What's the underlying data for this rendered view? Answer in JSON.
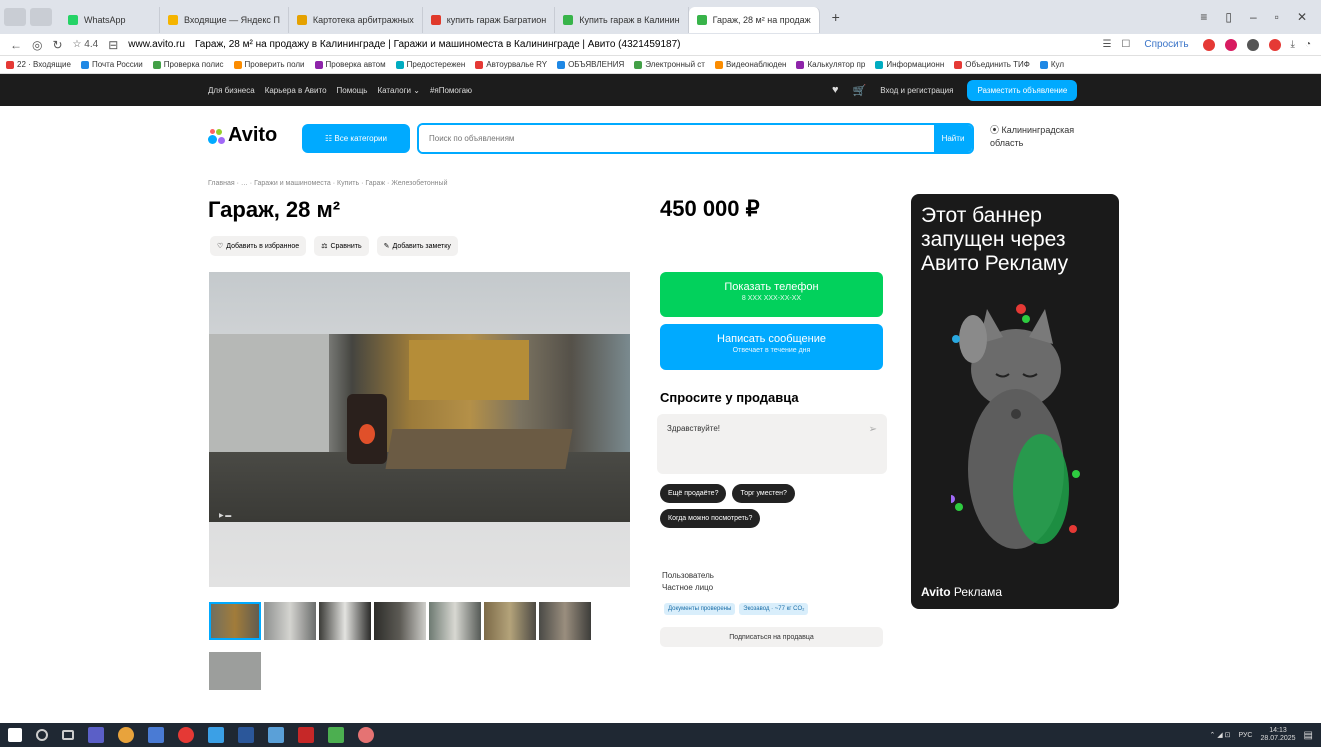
{
  "browser": {
    "tabs": [
      {
        "label": "WhatsApp",
        "color": "#25d366"
      },
      {
        "label": "Входящие — Яндекс П",
        "color": "#f5b400"
      },
      {
        "label": "Картотека арбитражных",
        "color": "#e5a100"
      },
      {
        "label": "купить гараж Багратион",
        "color": "#e0392b"
      },
      {
        "label": "Купить гараж в Калинин",
        "color": "#38b44a"
      },
      {
        "label": "Гараж, 28 м² на продаж",
        "color": "#38b44a",
        "active": true
      }
    ],
    "new_tab": "+",
    "rating": "☆ 4.4",
    "url": "www.avito.ru",
    "page_title": "Гараж, 28 м² на продажу в Калининграде | Гаражи и машиноместа в Калининграде | Авито (4321459187)",
    "ask_label": "Спросить",
    "bookmarks": [
      "22 · Входящие",
      "Почта России",
      "Проверка полис",
      "Проверить поли",
      "Проверка автом",
      "Предостережен",
      "Автоурвалье RY",
      "ОБЪЯВЛЕНИЯ",
      "Электронный ст",
      "Видеонаблюден",
      "Калькулятор пр",
      "Информационн",
      "Объединить ТИФ",
      "Кул"
    ]
  },
  "avito_top": {
    "links": [
      "Для бизнеса",
      "Карьера в Авито",
      "Помощь",
      "Каталоги ⌄",
      "#яПомогаю"
    ],
    "login": "Вход и регистрация",
    "post_button": "Разместить объявление"
  },
  "header": {
    "logo": "Avito",
    "categories_button": "☷ Все категории",
    "search_placeholder": "Поиск по объявлениям",
    "search_button": "Найти",
    "region": "Калининградская область"
  },
  "listing": {
    "breadcrumbs": "Главная · … · Гаражи и машиноместа · Купить · Гараж · Железобетонный",
    "title": "Гараж, 28 м²",
    "actions": {
      "favorite": "Добавить в избранное",
      "compare": "Сравнить",
      "note": "Добавить заметку"
    },
    "price": "450 000 ₽",
    "phone_button": "Показать телефон",
    "phone_masked": "8 XXX XXX-XX-XX",
    "message_button": "Написать сообщение",
    "message_sub": "Отвечает в течение дня",
    "ask_title": "Спросите у продавца",
    "ask_text": "Здравствуйте!",
    "quick_questions": [
      "Ещё продаёте?",
      "Торг уместен?",
      "Когда можно посмотреть?"
    ],
    "seller_role": "Пользователь",
    "seller_type": "Частное лицо",
    "badges": [
      "Документы проверены",
      "Экозавод · ~77 кг CO₂"
    ],
    "subscribe": "Подписаться на продавца"
  },
  "banner": {
    "headline": "Этот баннер запущен через Авито Рекламу",
    "logo_brand": "Avito",
    "logo_suffix": "Реклама"
  },
  "taskbar": {
    "lang": "РУС",
    "time": "14:13",
    "date": "28.07.2025"
  }
}
